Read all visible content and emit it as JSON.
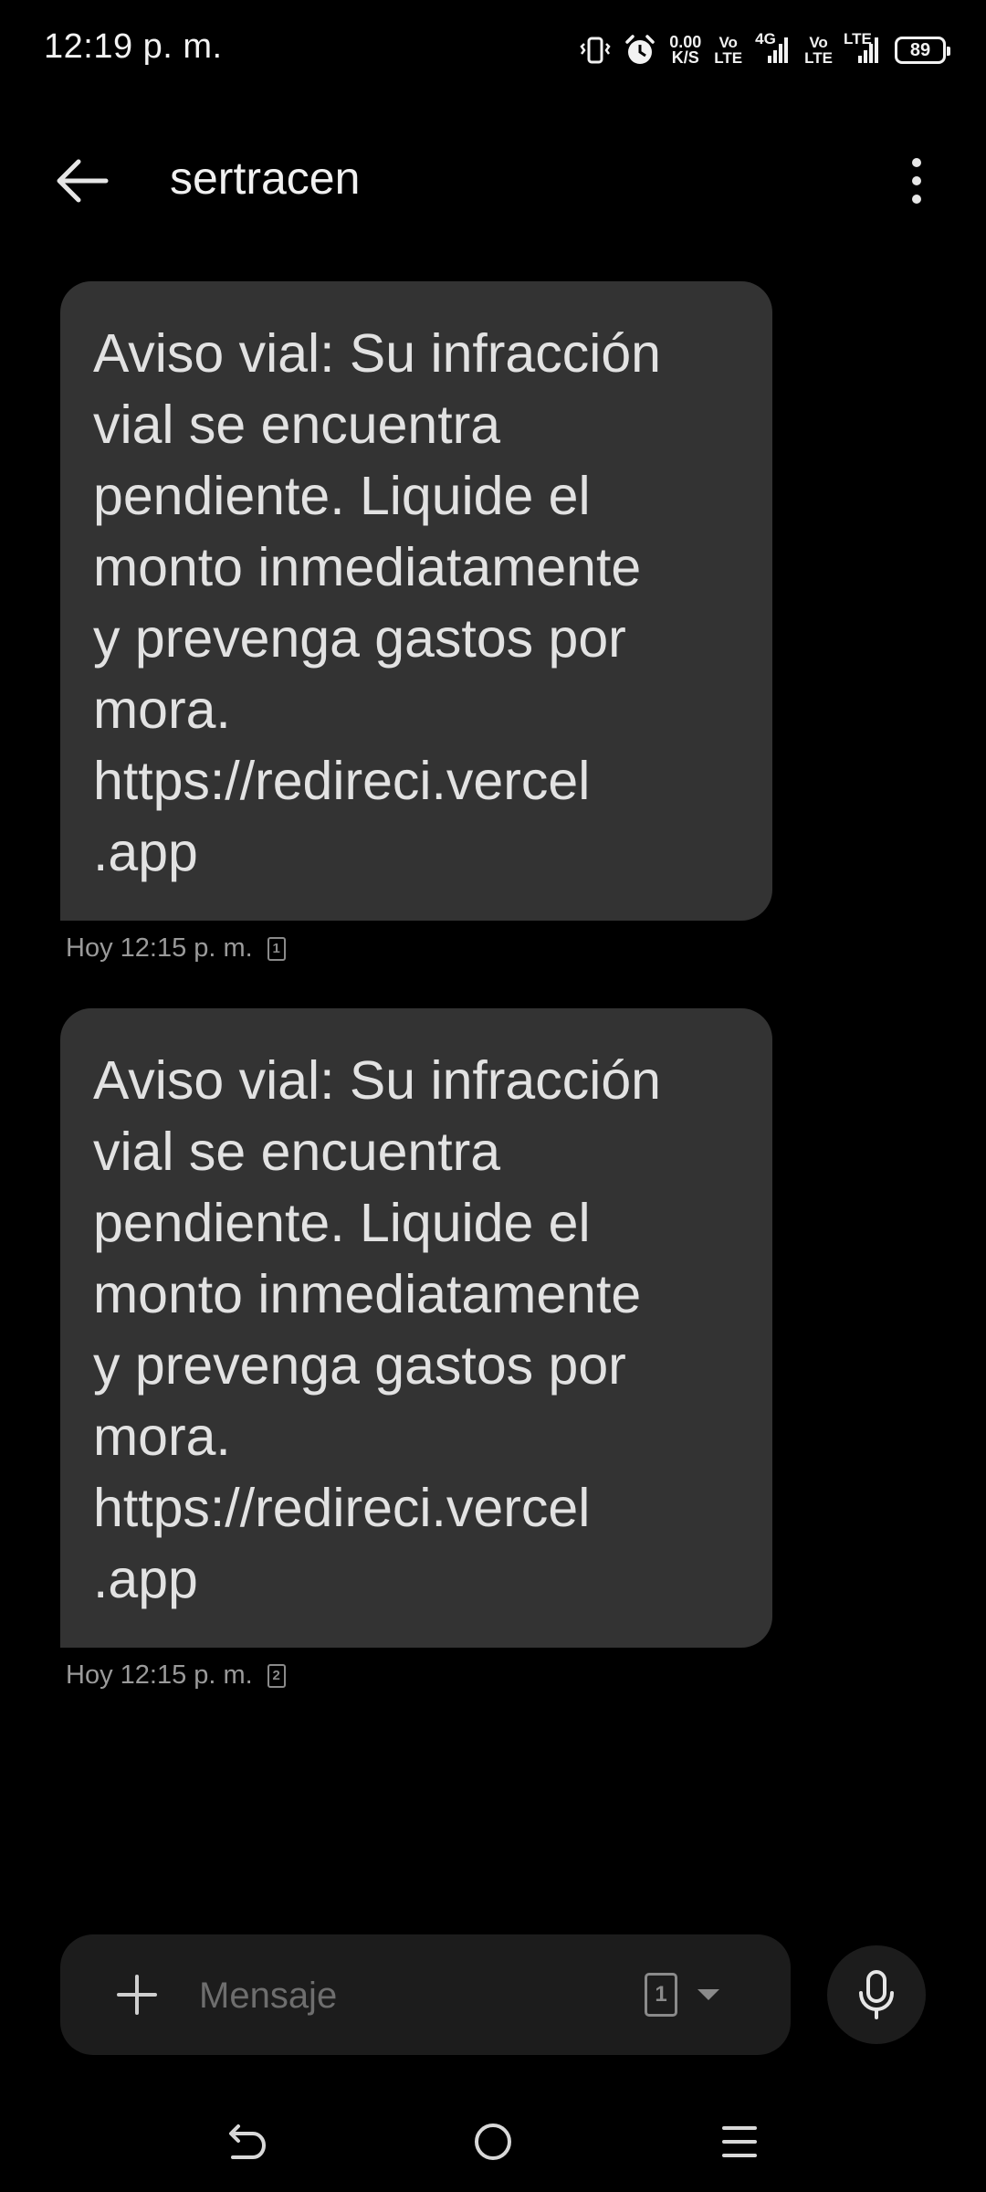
{
  "status_bar": {
    "time": "12:19 p. m.",
    "speed_value": "0.00",
    "speed_unit": "K/S",
    "volte1_top": "Vo",
    "volte1_bottom": "LTE",
    "network_label": "4G",
    "volte2_top": "Vo",
    "volte2_bottom": "LTE",
    "lte_label": "LTE",
    "battery_level": "89",
    "icons": [
      "vibrate-icon",
      "alarm-icon",
      "signal-icon",
      "battery-icon"
    ]
  },
  "header": {
    "back_icon": "arrow-left-icon",
    "title": "sertracen",
    "more_icon": "more-vert-icon"
  },
  "messages": [
    {
      "text": "Aviso vial: Su infracción\nvial se encuentra\npendiente. Liquide el\nmonto inmediatamente\ny prevenga gastos por\nmora.\nhttps://redireci.vercel\n.app",
      "timestamp": "Hoy 12:15 p. m.",
      "sim": "1"
    },
    {
      "text": "Aviso vial: Su infracción\nvial se encuentra\npendiente. Liquide el\nmonto inmediatamente\ny prevenga gastos por\nmora.\nhttps://redireci.vercel\n.app",
      "timestamp": "Hoy 12:15 p. m.",
      "sim": "2"
    }
  ],
  "composer": {
    "placeholder": "Mensaje",
    "value": "",
    "sim": "1",
    "add_icon": "plus-icon",
    "mic_icon": "microphone-icon"
  },
  "nav": {
    "icons": [
      "back-nav-icon",
      "home-nav-icon",
      "recents-menu-icon"
    ]
  },
  "colors": {
    "background": "#000000",
    "bubble": "#333333",
    "composer": "#1c1c1c",
    "text": "#e2e2e2",
    "meta_text": "#9a9a9a"
  }
}
